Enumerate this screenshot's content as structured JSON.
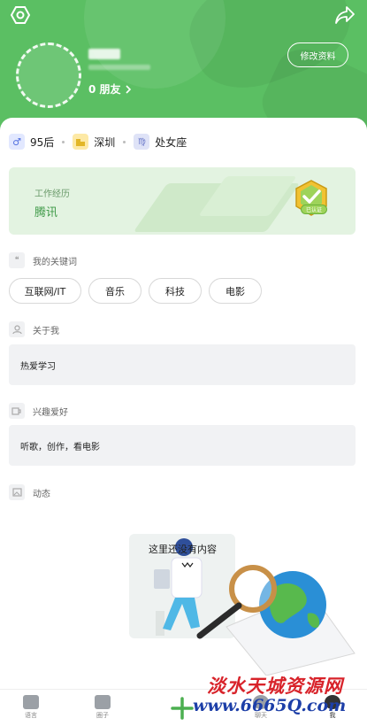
{
  "header": {
    "friends_text": "0 朋友",
    "edit_label": "修改资料",
    "bg_color": "#5bbf63"
  },
  "tags": [
    {
      "icon": "male-icon",
      "label": "95后"
    },
    {
      "icon": "building-icon",
      "label": "深圳"
    },
    {
      "icon": "zodiac-icon",
      "label": "处女座"
    }
  ],
  "work": {
    "label": "工作经历",
    "value": "腾讯",
    "verified_badge": "已认证"
  },
  "keywords": {
    "title": "我的关键词",
    "items": [
      "互联网/IT",
      "音乐",
      "科技",
      "电影"
    ]
  },
  "about": {
    "title": "关于我",
    "text": "热爱学习"
  },
  "hobbies": {
    "title": "兴趣爱好",
    "text": "听歌，创作，看电影"
  },
  "feed": {
    "title": "动态",
    "empty_text": "这里还没有内容"
  },
  "nav": {
    "items": [
      "语言",
      "圈子",
      "聊天",
      "我"
    ]
  },
  "watermark": {
    "line1": "淡水天城资源网",
    "line2": "www.6665Q.com"
  }
}
